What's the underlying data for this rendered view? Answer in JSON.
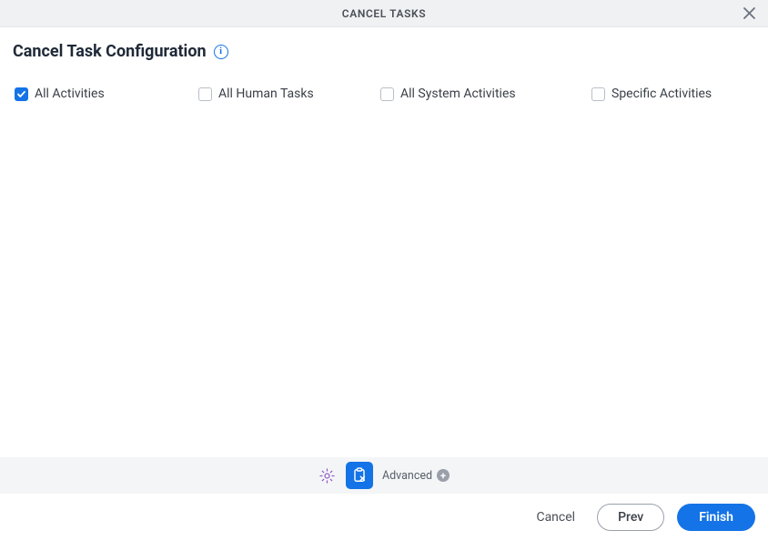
{
  "header": {
    "title": "CANCEL TASKS"
  },
  "section": {
    "title": "Cancel Task Configuration"
  },
  "options": [
    {
      "label": "All Activities",
      "checked": true
    },
    {
      "label": "All Human Tasks",
      "checked": false
    },
    {
      "label": "All System Activities",
      "checked": false
    },
    {
      "label": "Specific Activities",
      "checked": false
    }
  ],
  "advanced": {
    "label": "Advanced"
  },
  "footer": {
    "cancel": "Cancel",
    "prev": "Prev",
    "finish": "Finish"
  }
}
